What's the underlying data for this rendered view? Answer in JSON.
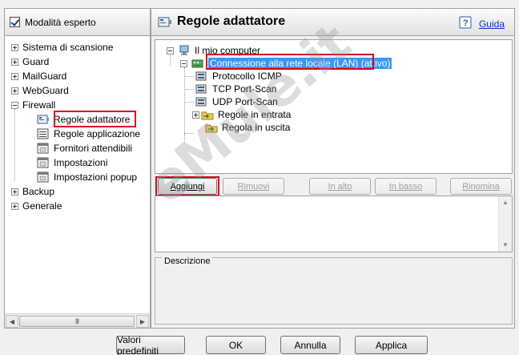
{
  "left_panel": {
    "expert_mode_label": "Modalità esperto",
    "tree": [
      {
        "label": "Sistema di scansione",
        "expander": "plus"
      },
      {
        "label": "Guard",
        "expander": "plus"
      },
      {
        "label": "MailGuard",
        "expander": "plus"
      },
      {
        "label": "WebGuard",
        "expander": "plus"
      },
      {
        "label": "Firewall",
        "expander": "minus"
      },
      {
        "label": "Regole adattatore",
        "child": true,
        "selected": true,
        "icon": "network-adapter-icon"
      },
      {
        "label": "Regole applicazione",
        "child": true,
        "icon": "app-list-icon"
      },
      {
        "label": "Fornitori attendibili",
        "child": true,
        "icon": "settings-window-icon"
      },
      {
        "label": "Impostazioni",
        "child": true,
        "icon": "settings-window-icon"
      },
      {
        "label": "Impostazioni popup",
        "child": true,
        "icon": "settings-window-icon"
      },
      {
        "label": "Backup",
        "expander": "plus"
      },
      {
        "label": "Generale",
        "expander": "plus"
      }
    ],
    "scroll_thumb_glyph": "III"
  },
  "right_panel": {
    "title": "Regole adattatore",
    "help_label": "Guida",
    "rules_tree": {
      "root": "Il mio computer",
      "connection": "Connessione alla rete locale (LAN) (attivo)",
      "items": [
        "Protocollo ICMP",
        "TCP Port-Scan",
        "UDP Port-Scan",
        "Regole in entrata",
        "Regola in uscita"
      ]
    },
    "buttons": {
      "add": "Aggiungi",
      "remove": "Rimuovi",
      "up": "In alto",
      "down": "In basso",
      "rename": "Rinomina"
    },
    "description_label": "Descrizione"
  },
  "dialog_buttons": {
    "defaults": "Valori predefiniti",
    "ok": "OK",
    "cancel": "Annulla",
    "apply": "Applica"
  },
  "watermark": "eMule.it",
  "colors": {
    "highlight_border": "#e0001a",
    "selection_bg": "#3399ff",
    "link": "#0033cc"
  }
}
